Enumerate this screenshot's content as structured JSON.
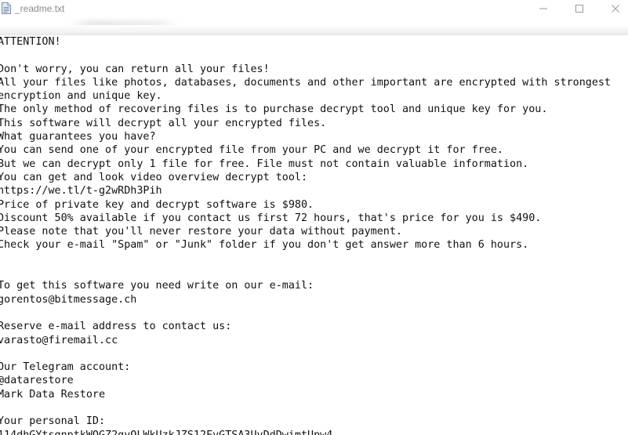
{
  "window": {
    "title": "_readme.txt",
    "minimize_symbol": "—",
    "maximize_symbol": "□",
    "close_symbol": "✕"
  },
  "document": {
    "lines": [
      "ATTENTION!",
      "",
      "Don't worry, you can return all your files!",
      "All your files like photos, databases, documents and other important are encrypted with strongest",
      "encryption and unique key.",
      "The only method of recovering files is to purchase decrypt tool and unique key for you.",
      "This software will decrypt all your encrypted files.",
      "What guarantees you have?",
      "You can send one of your encrypted file from your PC and we decrypt it for free.",
      "But we can decrypt only 1 file for free. File must not contain valuable information.",
      "You can get and look video overview decrypt tool:",
      "https://we.tl/t-g2wRDh3Pih",
      "Price of private key and decrypt software is $980.",
      "Discount 50% available if you contact us first 72 hours, that's price for you is $490.",
      "Please note that you'll never restore your data without payment.",
      "Check your e-mail \"Spam\" or \"Junk\" folder if you don't get answer more than 6 hours.",
      "",
      "",
      "To get this software you need write on our e-mail:",
      "gorentos@bitmessage.ch",
      "",
      "Reserve e-mail address to contact us:",
      "varasto@firemail.cc",
      "",
      "Our Telegram account:",
      "@datarestore",
      "Mark Data Restore",
      "",
      "Your personal ID:",
      "114dhGYtsgnptkWOGZ2gvOLWkUzkJZS12FvGTSA3UvDdDwimtUpw4"
    ]
  }
}
